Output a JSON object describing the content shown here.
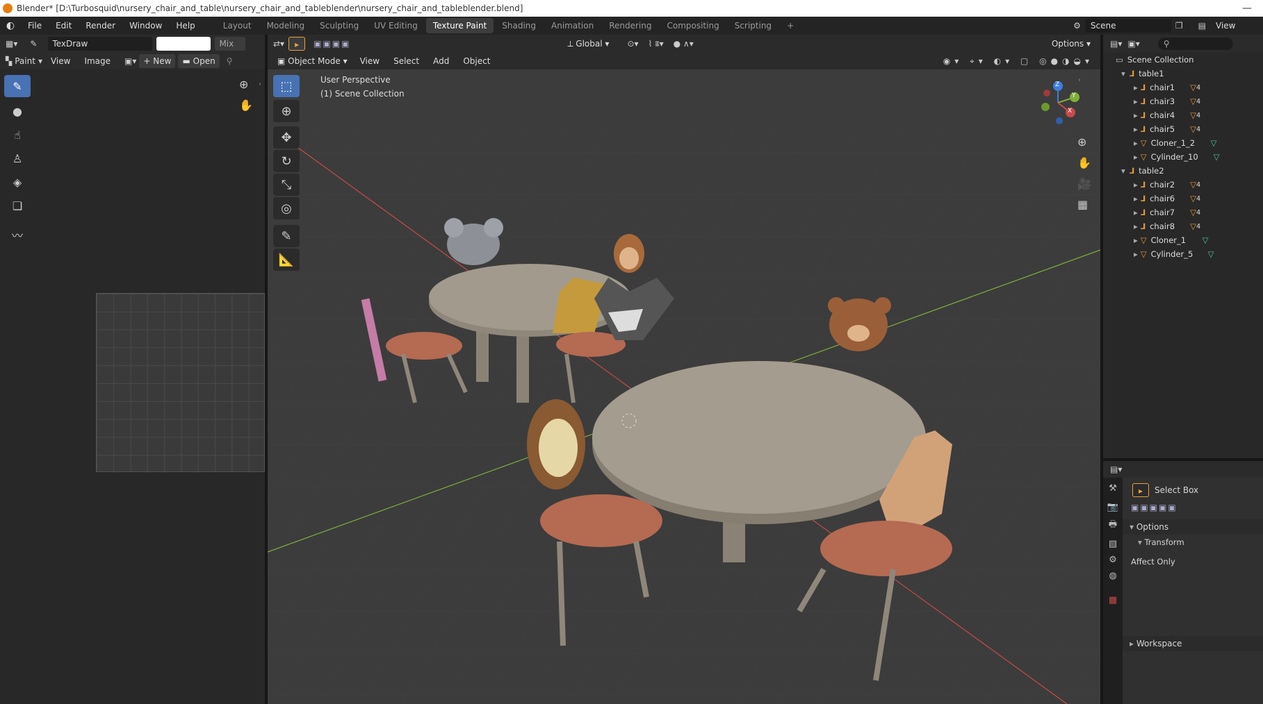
{
  "window": {
    "title": "Blender* [D:\\Turbosquid\\nursery_chair_and_table\\nursery_chair_and_tableblender\\nursery_chair_and_tableblender.blend]",
    "minimize": "—"
  },
  "menubar": {
    "items": [
      "File",
      "Edit",
      "Render",
      "Window",
      "Help"
    ]
  },
  "workspaces": {
    "tabs": [
      "Layout",
      "Modeling",
      "Sculpting",
      "UV Editing",
      "Texture Paint",
      "Shading",
      "Animation",
      "Rendering",
      "Compositing",
      "Scripting"
    ],
    "active": "Texture Paint",
    "add": "+"
  },
  "scene": {
    "name": "Scene",
    "view_layer": "View Layer"
  },
  "image_editor": {
    "brush_name": "TexDraw",
    "blend_mode": "Mix",
    "mode": "Paint",
    "menus": [
      "View",
      "Image"
    ],
    "new_label": "New",
    "open_label": "Open"
  },
  "viewport": {
    "mode": "Object Mode",
    "menus": [
      "View",
      "Select",
      "Add",
      "Object"
    ],
    "orientation": "Global",
    "options": "Options",
    "perspective": "User Perspective",
    "collection": "(1) Scene Collection",
    "gizmo_labels": {
      "z": "Z",
      "y": "Y",
      "x": "X"
    }
  },
  "outliner": {
    "root": "Scene Collection",
    "groups": [
      {
        "name": "table1",
        "children": [
          {
            "name": "chair1",
            "kind": "empty",
            "badge": "4"
          },
          {
            "name": "chair3",
            "kind": "empty",
            "badge": "4"
          },
          {
            "name": "chair4",
            "kind": "empty",
            "badge": "4"
          },
          {
            "name": "chair5",
            "kind": "empty",
            "badge": "4"
          },
          {
            "name": "Cloner_1_2",
            "kind": "mesh",
            "badge": ""
          },
          {
            "name": "Cylinder_10",
            "kind": "mesh",
            "badge": ""
          }
        ]
      },
      {
        "name": "table2",
        "children": [
          {
            "name": "chair2",
            "kind": "empty",
            "badge": "4"
          },
          {
            "name": "chair6",
            "kind": "empty",
            "badge": "4"
          },
          {
            "name": "chair7",
            "kind": "empty",
            "badge": "4"
          },
          {
            "name": "chair8",
            "kind": "empty",
            "badge": "4"
          },
          {
            "name": "Cloner_1",
            "kind": "mesh",
            "badge": ""
          },
          {
            "name": "Cylinder_5",
            "kind": "mesh",
            "badge": ""
          }
        ]
      }
    ]
  },
  "properties": {
    "tool_name": "Select Box",
    "options_label": "Options",
    "transform_label": "Transform",
    "affect_only": "Affect Only",
    "workspace_label": "Workspace"
  },
  "colors": {
    "accent": "#4772b3",
    "x_axis": "#c84a4a",
    "y_axis": "#7fb039",
    "z_axis": "#3c7fdb",
    "table": "#8f877a",
    "seat": "#b56a52"
  }
}
